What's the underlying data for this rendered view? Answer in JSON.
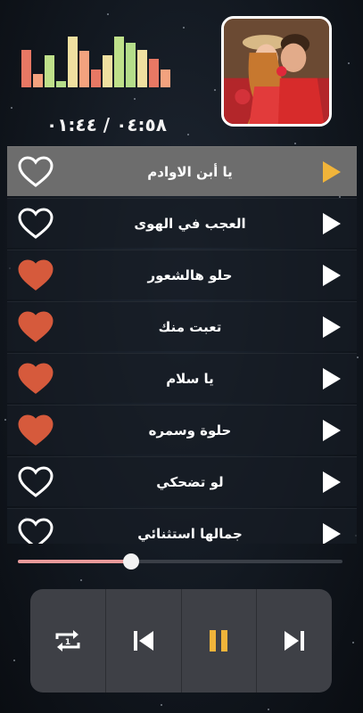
{
  "player": {
    "elapsed": "٠١:٤٤",
    "duration": "٠٤:٥٨",
    "progress_fraction": 0.35
  },
  "equalizer": {
    "levels": [
      0.72,
      0.25,
      0.62,
      0.12,
      0.98,
      0.7,
      0.35,
      0.62,
      0.98,
      0.86,
      0.72,
      0.55,
      0.35
    ],
    "colors": [
      "#e87864",
      "#f3a27e",
      "#bfe08a",
      "#b5dd8a",
      "#f0e0a0",
      "#f3a27e",
      "#e87864",
      "#f0e0a0",
      "#bfe08a",
      "#b5dd8a",
      "#f0e0a0",
      "#e87864",
      "#f3a27e"
    ]
  },
  "songs": [
    {
      "title": "يا أبن الاوادم",
      "favorite": false,
      "active": true
    },
    {
      "title": "العجب في الهوى",
      "favorite": false,
      "active": false
    },
    {
      "title": "حلو هالشعور",
      "favorite": true,
      "active": false
    },
    {
      "title": "تعبت منك",
      "favorite": true,
      "active": false
    },
    {
      "title": "يا سلام",
      "favorite": true,
      "active": false
    },
    {
      "title": "حلوة وسمره",
      "favorite": true,
      "active": false
    },
    {
      "title": "لو تضحكي",
      "favorite": false,
      "active": false
    },
    {
      "title": "جمالها استثنائي",
      "favorite": false,
      "active": false
    }
  ],
  "colors": {
    "accent_play": "#f0b43a",
    "heart_fav": "#d65a3c",
    "pause": "#f0b43a"
  },
  "icons": {
    "repeat": "repeat-one-icon",
    "previous": "skip-previous-icon",
    "pause": "pause-icon",
    "next": "skip-next-icon",
    "favorite": "heart-icon",
    "play": "play-icon"
  }
}
